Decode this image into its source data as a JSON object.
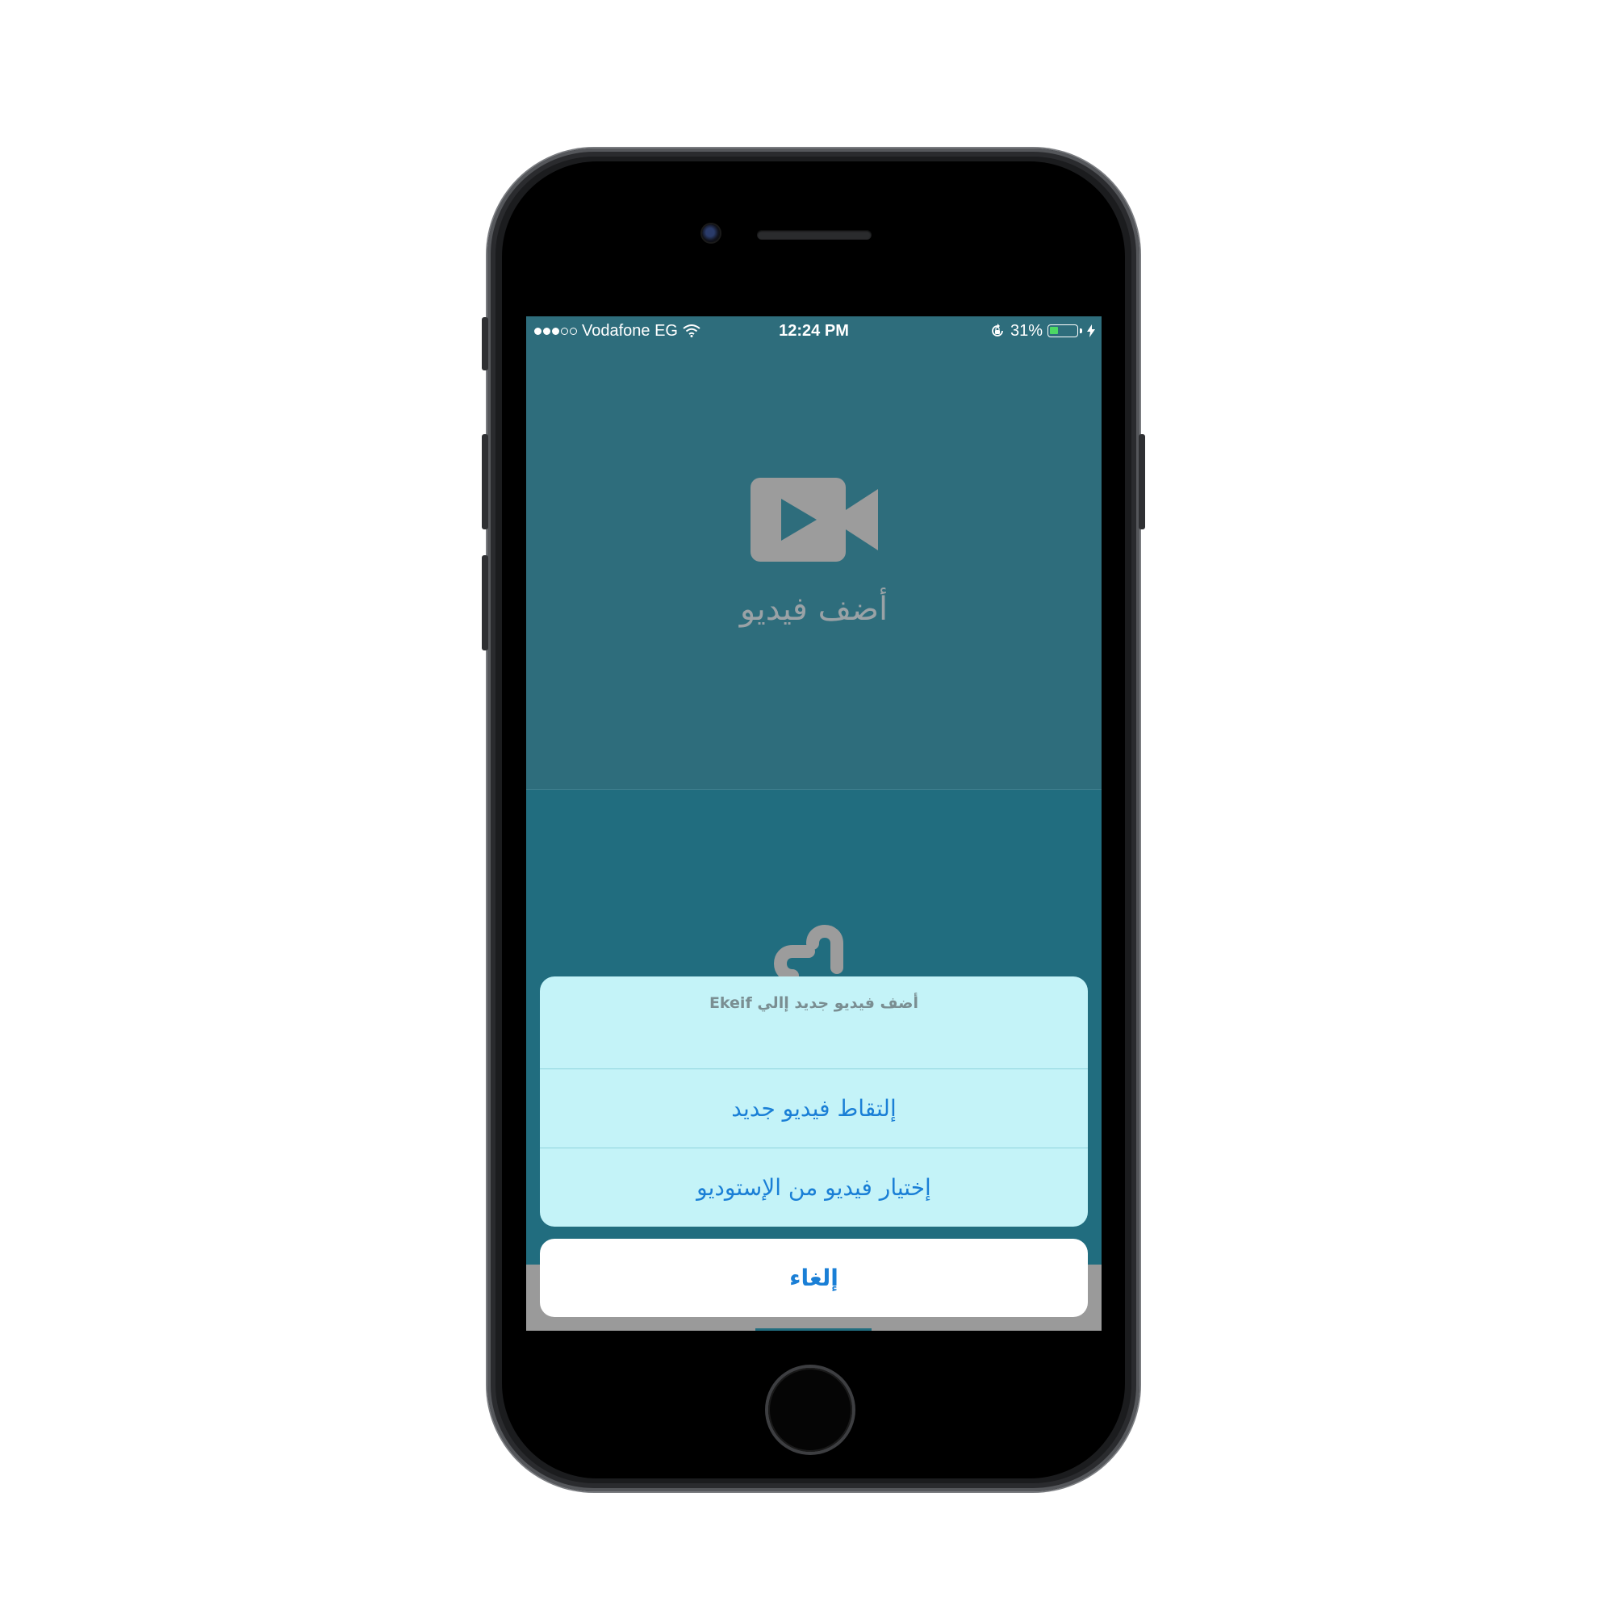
{
  "status_bar": {
    "carrier": "Vodafone EG",
    "signal_filled": 3,
    "signal_total": 5,
    "time": "12:24 PM",
    "battery_percent": "31%",
    "battery_level": 0.31,
    "battery_color": "#4cd964"
  },
  "main": {
    "add_video_label": "أضف فيديو",
    "add_video_icon": "video-camera-icon",
    "second_icon": "link-icon"
  },
  "action_sheet": {
    "title": "أضف فيديو جديد إالي Ekeif",
    "actions": [
      {
        "label": "إلتقاط فيديو جديد"
      },
      {
        "label": "إختيار فيديو من الإستوديو"
      }
    ],
    "cancel_label": "إلغاء"
  },
  "colors": {
    "top_background": "#2e6d7c",
    "bottom_background": "#216d7f",
    "sheet_background": "#c4f3f8",
    "action_text": "#1a7fd6"
  }
}
